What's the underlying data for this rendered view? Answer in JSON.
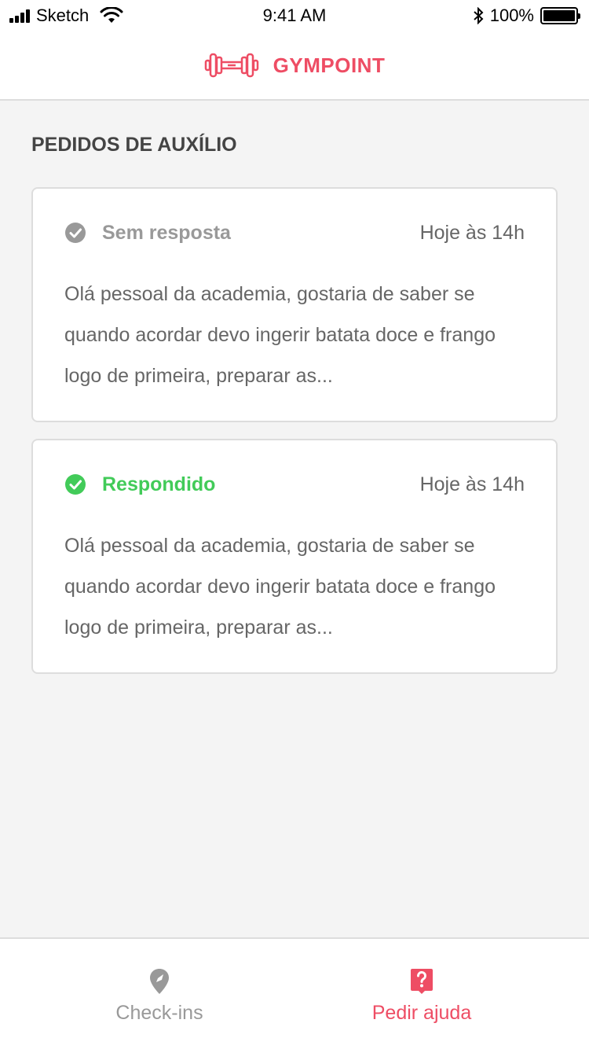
{
  "status_bar": {
    "carrier": "Sketch",
    "time": "9:41 AM",
    "battery": "100%"
  },
  "header": {
    "logo_text": "GYMPOINT",
    "logo_icon": "dumbbell-icon",
    "brand_color": "#ee4d64"
  },
  "page": {
    "title": "PEDIDOS DE AUXÍLIO"
  },
  "help_orders": [
    {
      "status": "Sem resposta",
      "status_icon": "check-circle-icon",
      "status_color": "#999999",
      "time": "Hoje às 14h",
      "question": "Olá pessoal da academia, gostaria de saber se quando acordar devo ingerir batata doce e frango logo de primeira, preparar as..."
    },
    {
      "status": "Respondido",
      "status_icon": "check-circle-icon",
      "status_color": "#42cb59",
      "time": "Hoje às 14h",
      "question": "Olá pessoal da academia, gostaria de saber se quando acordar devo ingerir batata doce e frango logo de primeira, preparar as..."
    }
  ],
  "tabs": [
    {
      "label": "Check-ins",
      "icon": "map-pin-icon",
      "active": false
    },
    {
      "label": "Pedir ajuda",
      "icon": "help-speech-bubble-icon",
      "active": true
    }
  ]
}
